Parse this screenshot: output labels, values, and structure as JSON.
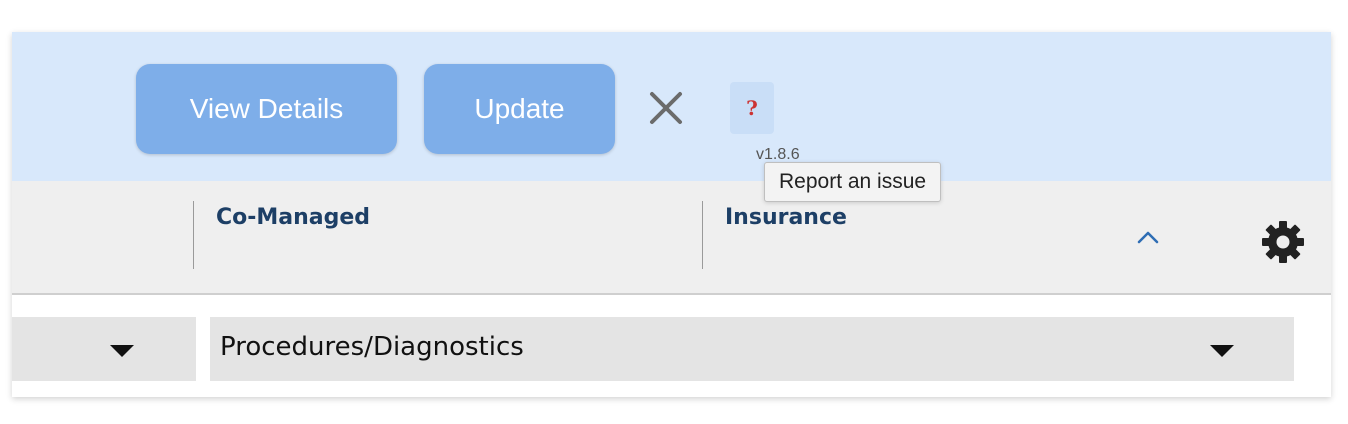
{
  "toolbar": {
    "view_details_label": "View Details",
    "update_label": "Update",
    "help_glyph": "?",
    "version": "v1.8.6",
    "tooltip": "Report an issue"
  },
  "columns": {
    "comanaged": "Co-Managed",
    "insurance": "Insurance"
  },
  "filters": {
    "left_value": "",
    "main_value": "Procedures/Diagnostics"
  },
  "icons": {
    "close": "close-icon",
    "help": "help-icon",
    "collapse": "chevron-up-icon",
    "settings": "gear-icon",
    "dropdown": "caret-down-icon"
  },
  "colors": {
    "topbar_bg": "#d8e8fb",
    "button_bg": "#7eaee9",
    "header_text": "#1d3f66",
    "help_glyph": "#cc3333"
  }
}
